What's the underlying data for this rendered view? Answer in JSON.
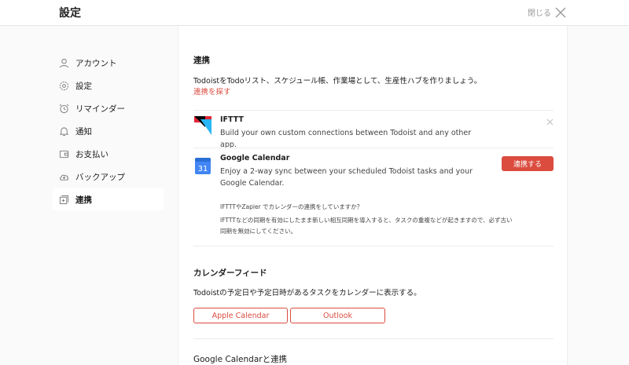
{
  "header": {
    "title": "設定",
    "close_label": "閉じる"
  },
  "sidebar": {
    "items": [
      {
        "label": "アカウント",
        "icon": "user-icon"
      },
      {
        "label": "設定",
        "icon": "gear-icon"
      },
      {
        "label": "リマインダー",
        "icon": "alarm-clock-icon"
      },
      {
        "label": "通知",
        "icon": "bell-icon"
      },
      {
        "label": "お支払い",
        "icon": "wallet-icon"
      },
      {
        "label": "バックアップ",
        "icon": "cloud-upload-icon"
      },
      {
        "label": "連携",
        "icon": "integration-plus-icon",
        "active": true
      }
    ]
  },
  "integrations": {
    "heading": "連携",
    "description": "TodoistをTodoリスト、スケジュール帳、作業場として、生産性ハブを作りましょう。",
    "find_link": "連携を探す",
    "items": [
      {
        "name": "IFTTT",
        "description": "Build your own custom connections between Todoist and any other app."
      },
      {
        "name": "Google Calendar",
        "description": "Enjoy a 2-way sync between your scheduled Todoist tasks and your Google Calendar.",
        "button_label": "連携する",
        "logo_text": "31",
        "note_question": "IFTTTやZapier でカレンダーの連携をしていますか？",
        "note_line1": "IFTTTなどの同期を有効にしたまま新しい相互同期を導入すると、タスクの重複などが起きますので、必ず古い",
        "note_line2": "同期を無効にしてください。"
      }
    ]
  },
  "calendar_feed": {
    "heading": "カレンダーフィード",
    "description": "Todoistの予定日や予定日時があるタスクをカレンダーに表示する。",
    "buttons": [
      "Apple Calendar",
      "Outlook"
    ]
  },
  "google_section": {
    "heading": "Google Calendarと連携"
  },
  "colors": {
    "accent": "#db4c3f",
    "google_blue": "#4285f4"
  }
}
